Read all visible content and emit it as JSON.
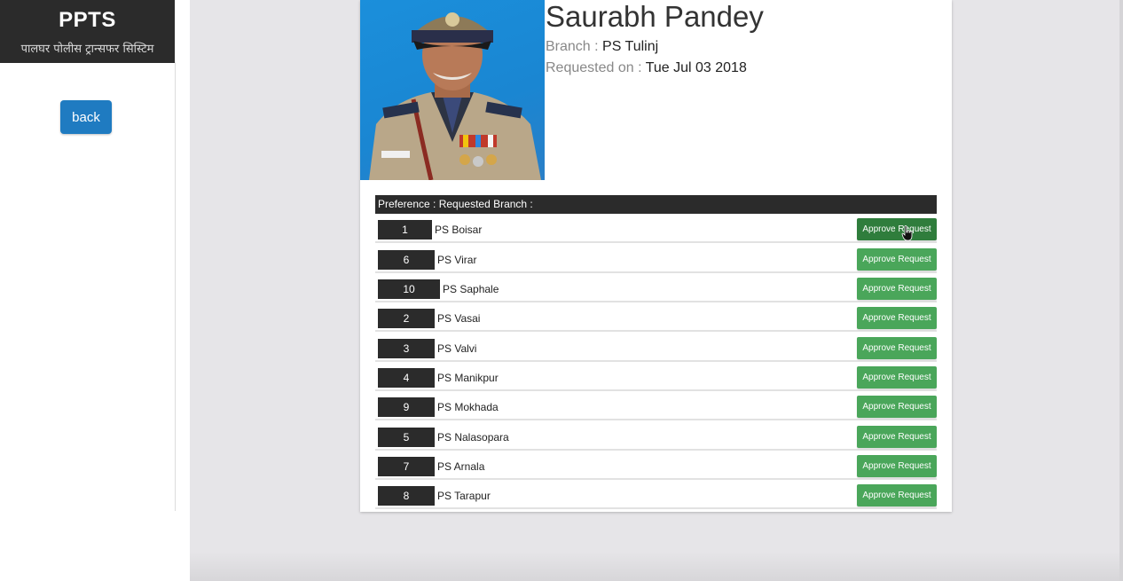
{
  "sidebar": {
    "brand_title": "PPTS",
    "brand_subtitle": "पालघर पोलीस ट्रान्सफर सिस्टिम",
    "back_label": "back"
  },
  "profile": {
    "name": "Saurabh Pandey",
    "branch_label": "Branch : ",
    "branch_value": "PS Tulinj",
    "requested_label": "Requested on : ",
    "requested_value": "Tue Jul 03 2018"
  },
  "preferences": {
    "header": "Preference : Requested Branch :",
    "approve_label": "Approve Request",
    "rows": [
      {
        "rank": "1",
        "branch": "PS Boisar"
      },
      {
        "rank": "6",
        "branch": "PS Virar"
      },
      {
        "rank": "10",
        "branch": "PS Saphale"
      },
      {
        "rank": "2",
        "branch": "PS Vasai"
      },
      {
        "rank": "3",
        "branch": "PS Valvi"
      },
      {
        "rank": "4",
        "branch": "PS Manikpur"
      },
      {
        "rank": "9",
        "branch": "PS Mokhada"
      },
      {
        "rank": "5",
        "branch": "PS Nalasopara"
      },
      {
        "rank": "7",
        "branch": "PS Arnala"
      },
      {
        "rank": "8",
        "branch": "PS Tarapur"
      }
    ]
  },
  "colors": {
    "brand_bg": "#2b2b2b",
    "back_button": "#1f7bc1",
    "approve_button": "#4aa65a",
    "approve_button_hover": "#2f7d3c"
  },
  "icons": {
    "cursor": "hand-pointer-icon"
  }
}
